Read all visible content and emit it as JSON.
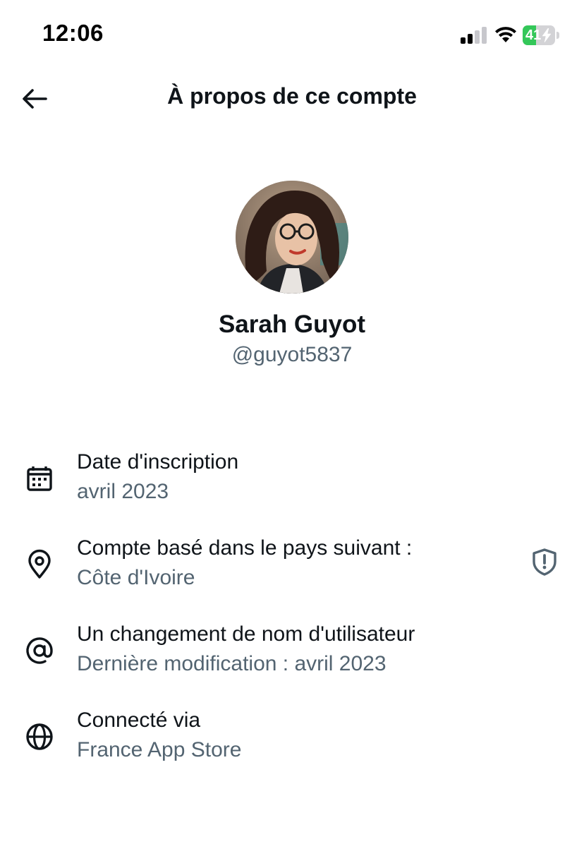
{
  "status_bar": {
    "time": "12:06",
    "battery_level": "41",
    "battery_fraction": 0.41,
    "battery_color": "#34c759"
  },
  "header": {
    "back_icon": "arrow-left-icon",
    "title": "À propos de ce compte"
  },
  "profile": {
    "name": "Sarah Guyot",
    "handle": "@guyot5837"
  },
  "info": [
    {
      "icon": "calendar-icon",
      "title": "Date d'inscription",
      "value": "avril 2023"
    },
    {
      "icon": "location-pin-icon",
      "title": "Compte basé dans le pays suivant :",
      "value": "Côte d'Ivoire",
      "trailing_icon": "shield-alert-icon"
    },
    {
      "icon": "at-sign-icon",
      "title": "Un changement de nom d'utilisateur",
      "value": "Dernière modification : avril 2023"
    },
    {
      "icon": "globe-icon",
      "title": "Connecté via",
      "value": "France App Store"
    }
  ],
  "colors": {
    "primary_text": "#0f1419",
    "secondary_text": "#536471"
  }
}
